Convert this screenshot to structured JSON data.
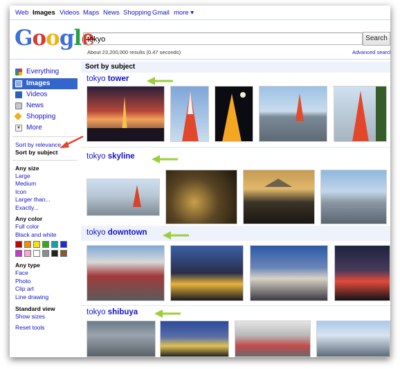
{
  "topnav": {
    "items": [
      "Web",
      "Images",
      "Videos",
      "Maps",
      "News",
      "Shopping",
      "Gmail",
      "more ▾"
    ],
    "active": "Images"
  },
  "logo": {
    "text": "Google"
  },
  "search": {
    "value": "tokyo",
    "button_label": "Search"
  },
  "results_info": "About 23,200,000 results (0.47 seconds)",
  "advanced_search": "Advanced search",
  "sidebar": {
    "types": [
      {
        "label": "Everything",
        "icon": "everything-icon",
        "selected": false
      },
      {
        "label": "Images",
        "icon": "images-icon",
        "selected": true
      },
      {
        "label": "Videos",
        "icon": "videos-icon",
        "selected": false
      },
      {
        "label": "News",
        "icon": "news-icon",
        "selected": false
      },
      {
        "label": "Shopping",
        "icon": "shopping-icon",
        "selected": false
      },
      {
        "label": "More",
        "icon": "more-icon",
        "selected": false
      }
    ],
    "sort_relevance": "Sort by relevance",
    "sort_subject": "Sort by subject",
    "size_header": "Any size",
    "sizes": [
      "Large",
      "Medium",
      "Icon",
      "Larger than...",
      "Exactly..."
    ],
    "color_header": "Any color",
    "colors": [
      "Full color",
      "Black and white"
    ],
    "swatches": [
      "#cc0000",
      "#f28c00",
      "#f3e600",
      "#33aa22",
      "#00a8b0",
      "#1d2bd9",
      "#c23bd0",
      "#f5a7d6",
      "#ffffff",
      "#8c8c8c",
      "#222222",
      "#8b5a2b"
    ],
    "type_header": "Any type",
    "types_list": [
      "Face",
      "Photo",
      "Clip art",
      "Line drawing"
    ],
    "view_header": "Standard view",
    "show_sizes": "Show sizes",
    "reset": "Reset tools"
  },
  "main": {
    "sort_heading": "Sort by subject",
    "sections": [
      {
        "prefix": "tokyo",
        "subject": "tower"
      },
      {
        "prefix": "tokyo",
        "subject": "skyline"
      },
      {
        "prefix": "tokyo",
        "subject": "downtown"
      },
      {
        "prefix": "tokyo",
        "subject": "shibuya"
      }
    ]
  },
  "colors": {
    "link": "#1111cc",
    "accent": "#3366cc",
    "arrow_green": "#9bcf3a",
    "arrow_red": "#e8412b"
  }
}
